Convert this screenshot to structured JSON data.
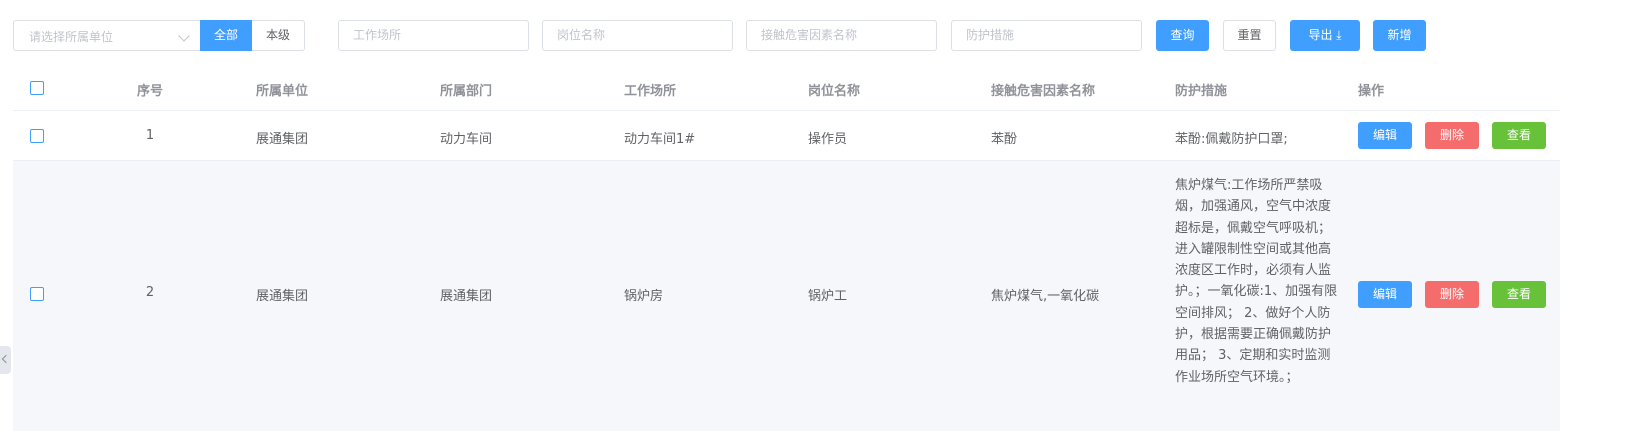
{
  "toolbar": {
    "unit_select_placeholder": "请选择所属单位",
    "scope_all": "全部",
    "scope_self": "本级",
    "place_placeholder": "工作场所",
    "post_placeholder": "岗位名称",
    "hazard_placeholder": "接触危害因素名称",
    "protection_placeholder": "防护措施",
    "query_label": "查询",
    "reset_label": "重置",
    "export_label": "导出 ⤓",
    "add_label": "新增"
  },
  "table": {
    "headers": {
      "seq": "序号",
      "unit": "所属单位",
      "dept": "所属部门",
      "place": "工作场所",
      "post": "岗位名称",
      "hazard": "接触危害因素名称",
      "protection": "防护措施",
      "ops": "操作"
    },
    "rows": [
      {
        "seq": "1",
        "unit": "展通集团",
        "dept": "动力车间",
        "place": "动力车间1#",
        "post": "操作员",
        "hazard": "苯酚",
        "protection": "苯酚:佩戴防护口罩;"
      },
      {
        "seq": "2",
        "unit": "展通集团",
        "dept": "展通集团",
        "place": "锅炉房",
        "post": "锅炉工",
        "hazard": "焦炉煤气,一氧化碳",
        "protection": "焦炉煤气:工作场所严禁吸烟，加强通风，空气中浓度超标是，佩戴空气呼吸机；进入罐限制性空间或其他高浓度区工作时，必须有人监护。；一氧化碳:1、加强有限空间排风； 2、做好个人防护，根据需要正确佩戴防护用品； 3、定期和实时监测作业场所空气环境。；"
      }
    ],
    "actions": {
      "edit": "编辑",
      "delete": "删除",
      "view": "查看"
    }
  },
  "colors": {
    "primary": "#409eff",
    "danger": "#f56c6c",
    "success": "#67c23a",
    "row_alt": "#f5f7fa"
  }
}
